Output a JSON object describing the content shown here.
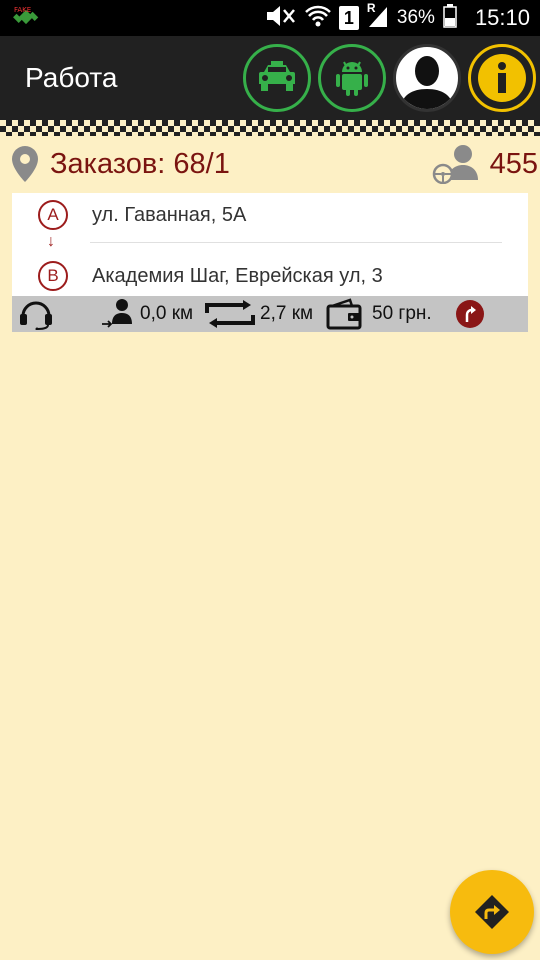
{
  "status_bar": {
    "sim_slot": "1",
    "roaming": "R",
    "battery": "36%",
    "time": "15:10"
  },
  "toolbar": {
    "title": "Работа",
    "buttons": [
      {
        "name": "taxi-button",
        "icon": "taxi-car-icon"
      },
      {
        "name": "android-button",
        "icon": "android-icon"
      },
      {
        "name": "profile-button",
        "icon": "user-avatar-icon"
      },
      {
        "name": "info-button",
        "icon": "info-icon"
      }
    ]
  },
  "orders": {
    "label": "Заказов: 68/1",
    "drivers_count": "455"
  },
  "order_card": {
    "point_a": "A",
    "point_b": "B",
    "address_a": "ул. Гаванная, 5А",
    "address_b": "Академия Шаг, Еврейская ул, 3",
    "distance_to_client": "0,0 км",
    "route_distance": "2,7 км",
    "price": "50 грн."
  },
  "colors": {
    "background": "#fdf0c5",
    "toolbar": "#212121",
    "accent_red": "#7a1410",
    "accent_green": "#36b04a",
    "accent_yellow": "#f2c100",
    "fab": "#f7bb0e"
  }
}
